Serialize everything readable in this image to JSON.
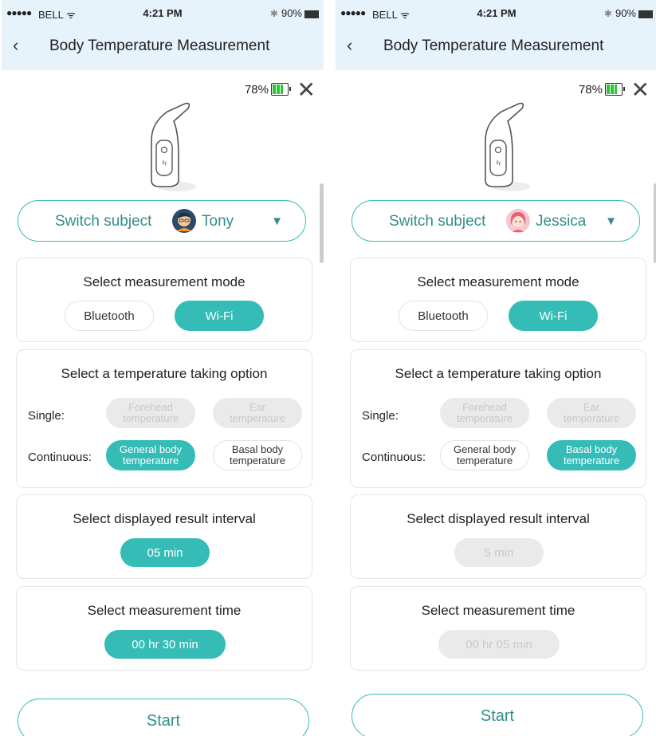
{
  "status_bar": {
    "signal": "●●●●●",
    "carrier": "BELL",
    "time": "4:21 PM",
    "battery": "90%"
  },
  "screens": [
    {
      "nav_title": "Body Temperature Measurement",
      "device_battery": "78%",
      "subject_label": "Switch subject",
      "subject_name": "Tony",
      "mode_title": "Select measurement mode",
      "mode_options": [
        "Bluetooth",
        "Wi-Fi"
      ],
      "mode_selected": "Wi-Fi",
      "option_title": "Select a temperature taking option",
      "single_label": "Single:",
      "continuous_label": "Continuous:",
      "forehead_l1": "Forehead",
      "forehead_l2": "temperature",
      "ear_l1": "Ear",
      "ear_l2": "temperature",
      "general_l1": "General body",
      "general_l2": "temperature",
      "basal_l1": "Basal body",
      "basal_l2": "temperature",
      "continuous_selected": "General body temperature",
      "interval_title": "Select displayed result interval",
      "interval_value": "05 min",
      "interval_enabled": true,
      "time_title": "Select measurement time",
      "time_value": "00 hr 30 min",
      "time_enabled": true,
      "start_label": "Start"
    },
    {
      "nav_title": "Body Temperature Measurement",
      "device_battery": "78%",
      "subject_label": "Switch subject",
      "subject_name": "Jessica",
      "mode_title": "Select measurement mode",
      "mode_options": [
        "Bluetooth",
        "Wi-Fi"
      ],
      "mode_selected": "Wi-Fi",
      "option_title": "Select a temperature taking option",
      "single_label": "Single:",
      "continuous_label": "Continuous:",
      "forehead_l1": "Forehead",
      "forehead_l2": "temperature",
      "ear_l1": "Ear",
      "ear_l2": "temperature",
      "general_l1": "General body",
      "general_l2": "temperature",
      "basal_l1": "Basal body",
      "basal_l2": "temperature",
      "continuous_selected": "Basal body temperature",
      "interval_title": "Select displayed result interval",
      "interval_value": "5 min",
      "interval_enabled": false,
      "time_title": "Select measurement time",
      "time_value": "00 hr 05 min",
      "time_enabled": false,
      "start_label": "Start"
    }
  ],
  "colors": {
    "accent": "#35bcb7",
    "header_bg": "#e6f3fa",
    "disabled": "#eaeaea",
    "battery_green": "#2ec33a"
  }
}
